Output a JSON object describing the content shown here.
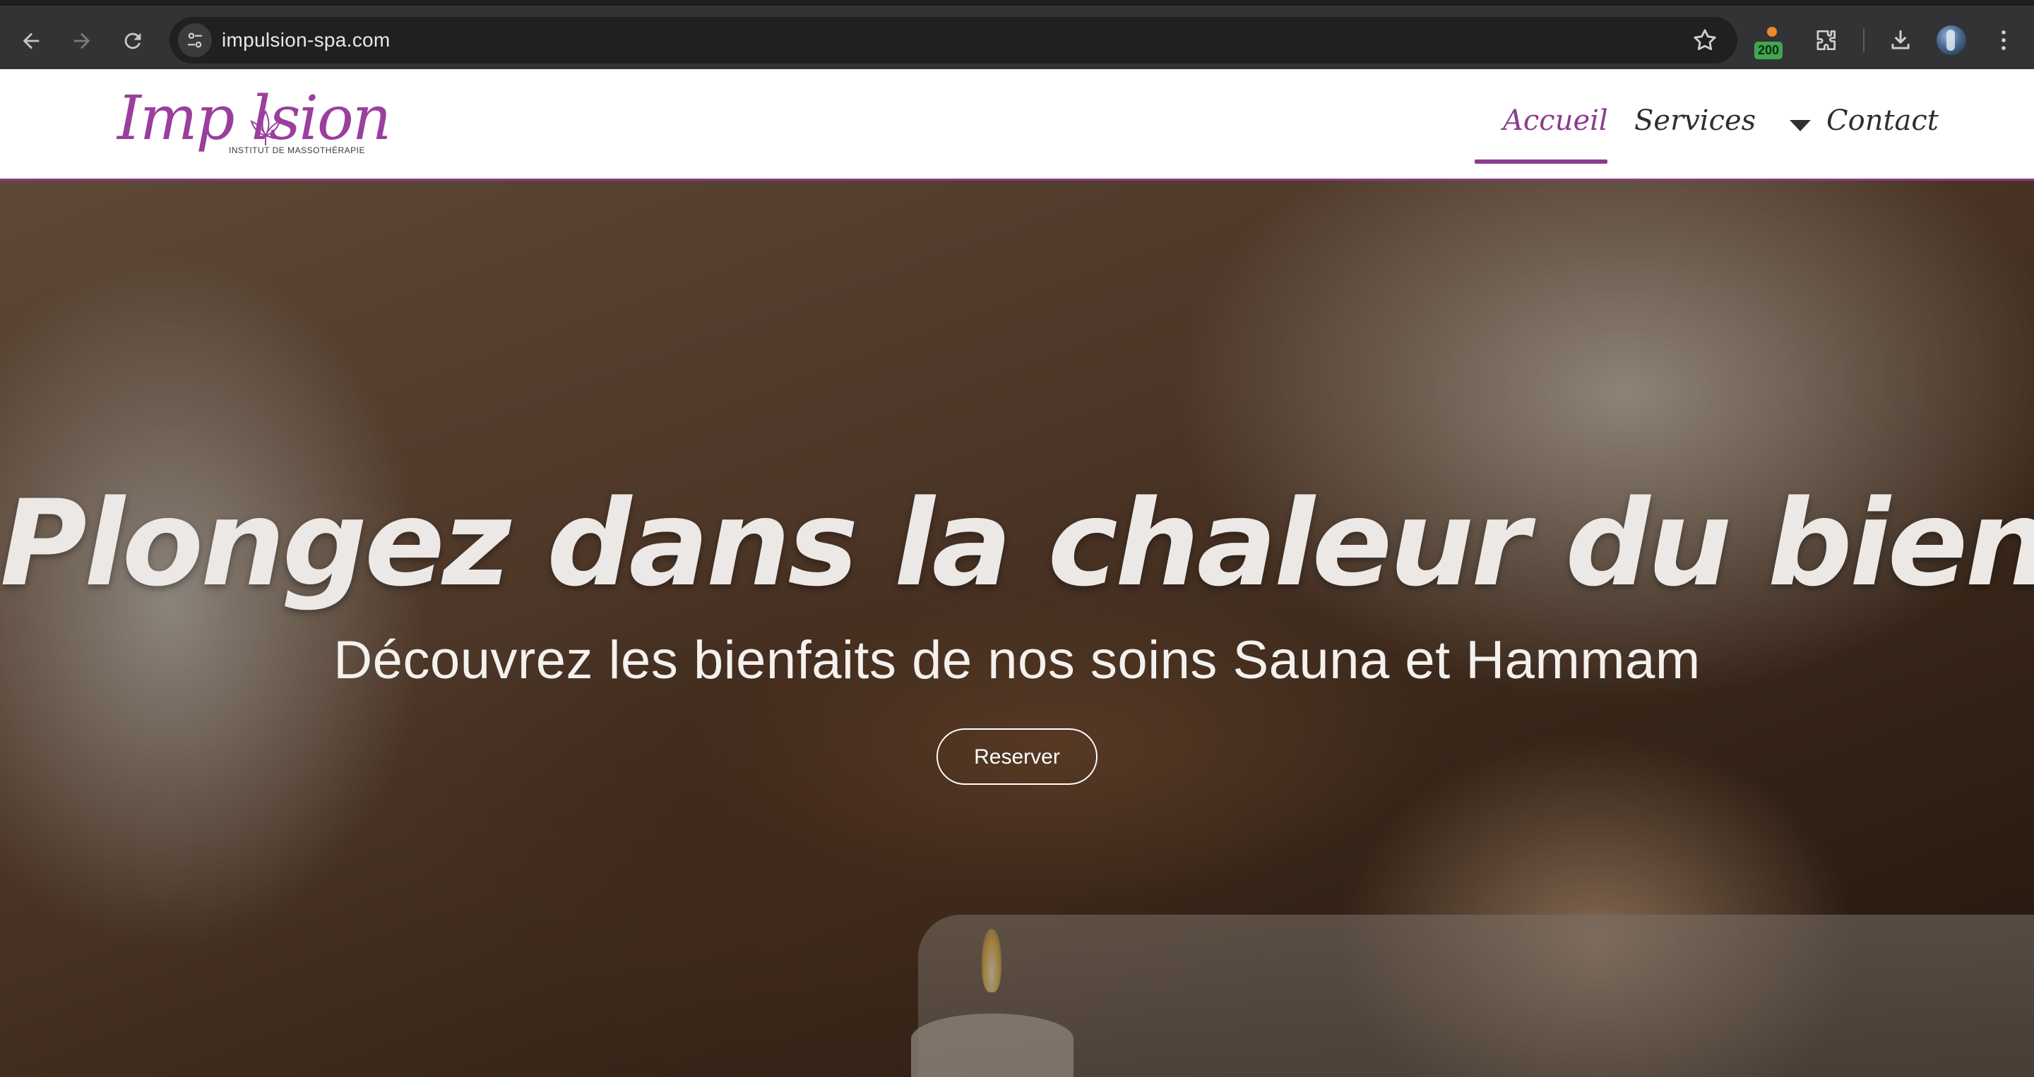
{
  "browser": {
    "url": "impulsion-spa.com",
    "extension_badge": "200",
    "icons": {
      "back": "arrow-left-icon",
      "forward": "arrow-right-icon",
      "reload": "reload-icon",
      "site_info": "tune-icon",
      "bookmark": "star-icon",
      "extensions": "puzzle-icon",
      "downloads": "download-icon",
      "menu": "kebab-menu-icon"
    }
  },
  "site": {
    "logo": {
      "script": "Imp  lsion",
      "tagline": "INSTITUT DE MASSOTHÉRAPIE"
    },
    "nav": {
      "home": "Accueil",
      "services": "Services",
      "contact": "Contact"
    },
    "colors": {
      "brand": "#8a3c8e",
      "nav_text": "#2f2f2f",
      "header_bg": "#ffffff"
    }
  },
  "hero": {
    "title": "Plongez dans la chaleur du bien-être.",
    "subtitle": "Découvrez les bienfaits de nos soins Sauna et Hammam",
    "cta": "Reserver"
  }
}
